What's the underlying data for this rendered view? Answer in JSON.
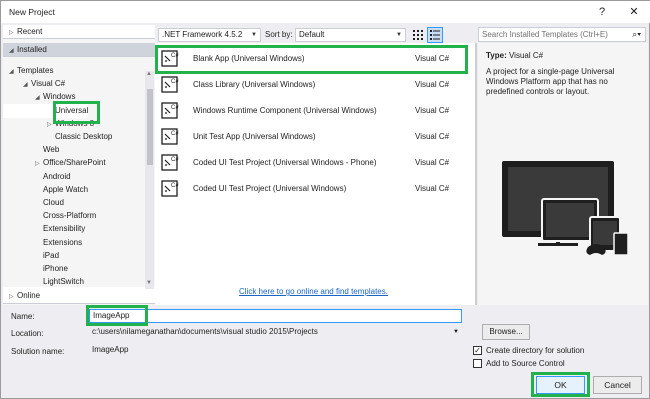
{
  "window": {
    "title": "New Project",
    "help_label": "?",
    "close_label": "✕"
  },
  "nav": {
    "recent": "Recent",
    "installed": "Installed",
    "tree": [
      {
        "label": "Templates",
        "arrow": "◢"
      },
      {
        "label": "Visual C#",
        "arrow": "◢"
      },
      {
        "label": "Windows",
        "arrow": "◢"
      },
      {
        "label": "Universal",
        "arrow": ""
      },
      {
        "label": "Windows 8",
        "arrow": "▷"
      },
      {
        "label": "Classic Desktop",
        "arrow": ""
      },
      {
        "label": "Web",
        "arrow": ""
      },
      {
        "label": "Office/SharePoint",
        "arrow": "▷"
      },
      {
        "label": "Android",
        "arrow": ""
      },
      {
        "label": "Apple Watch",
        "arrow": ""
      },
      {
        "label": "Cloud",
        "arrow": ""
      },
      {
        "label": "Cross-Platform",
        "arrow": ""
      },
      {
        "label": "Extensibility",
        "arrow": ""
      },
      {
        "label": "Extensions",
        "arrow": ""
      },
      {
        "label": "iPad",
        "arrow": ""
      },
      {
        "label": "iPhone",
        "arrow": ""
      },
      {
        "label": "LightSwitch",
        "arrow": ""
      }
    ],
    "online": "Online"
  },
  "toolbar": {
    "framework": ".NET Framework 4.5.2",
    "sort_label": "Sort by:",
    "sort_value": "Default",
    "search_placeholder": "Search Installed Templates (Ctrl+E)"
  },
  "templates": [
    {
      "name": "Blank App (Universal Windows)",
      "lang": "Visual C#"
    },
    {
      "name": "Class Library (Universal Windows)",
      "lang": "Visual C#"
    },
    {
      "name": "Windows Runtime Component (Universal Windows)",
      "lang": "Visual C#"
    },
    {
      "name": "Unit Test App (Universal Windows)",
      "lang": "Visual C#"
    },
    {
      "name": "Coded UI Test Project (Universal Windows - Phone)",
      "lang": "Visual C#"
    },
    {
      "name": "Coded UI Test Project (Universal Windows)",
      "lang": "Visual C#"
    }
  ],
  "online_link": "Click here to go online and find templates.",
  "detail": {
    "type_label": "Type:",
    "type_value": "Visual C#",
    "description": "A project for a single-page Universal Windows Platform app that has no predefined controls or layout."
  },
  "form": {
    "name_label": "Name:",
    "name_value": "ImageApp",
    "location_label": "Location:",
    "location_value": "c:\\users\\nilameganathan\\documents\\visual studio 2015\\Projects",
    "solution_label": "Solution name:",
    "solution_value": "ImageApp",
    "browse_label": "Browse...",
    "create_dir_label": "Create directory for solution",
    "create_dir_checked": true,
    "source_control_label": "Add to Source Control",
    "source_control_checked": false,
    "ok_label": "OK",
    "cancel_label": "Cancel"
  },
  "colors": {
    "highlight": "#21b24b",
    "link": "#1a64c4",
    "selected_bg": "#cfd3dc"
  }
}
